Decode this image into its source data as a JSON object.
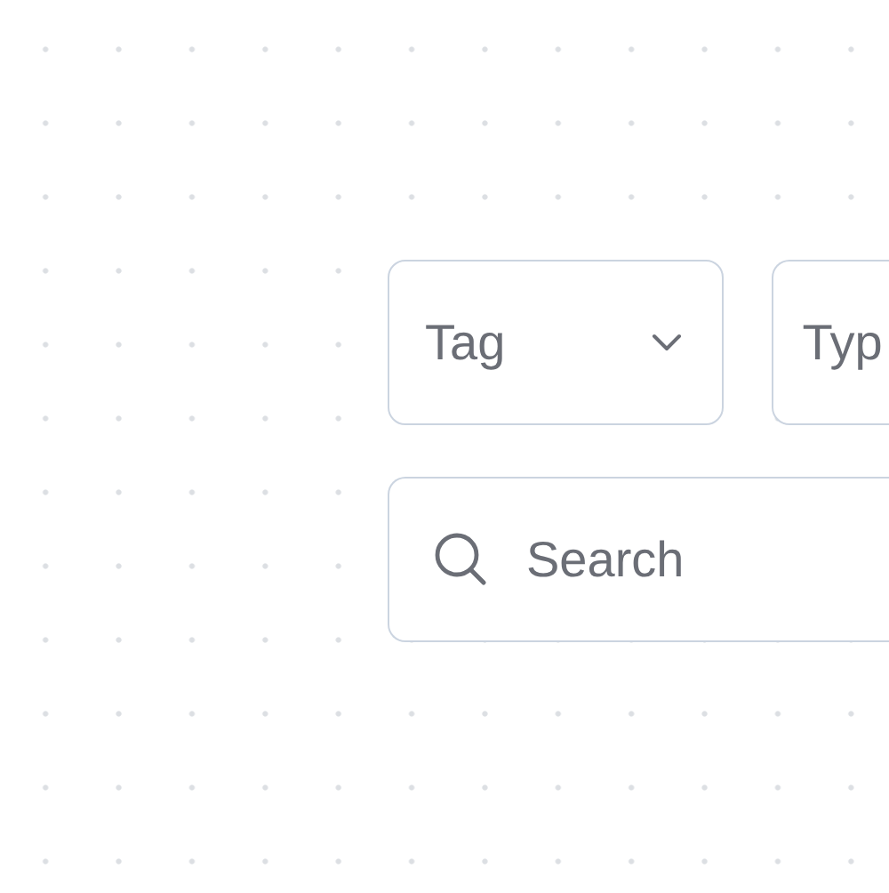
{
  "filters": [
    {
      "label": "Tag",
      "caret": true
    },
    {
      "label": "Typ",
      "caret": false
    }
  ],
  "search": {
    "placeholder": "Search"
  }
}
